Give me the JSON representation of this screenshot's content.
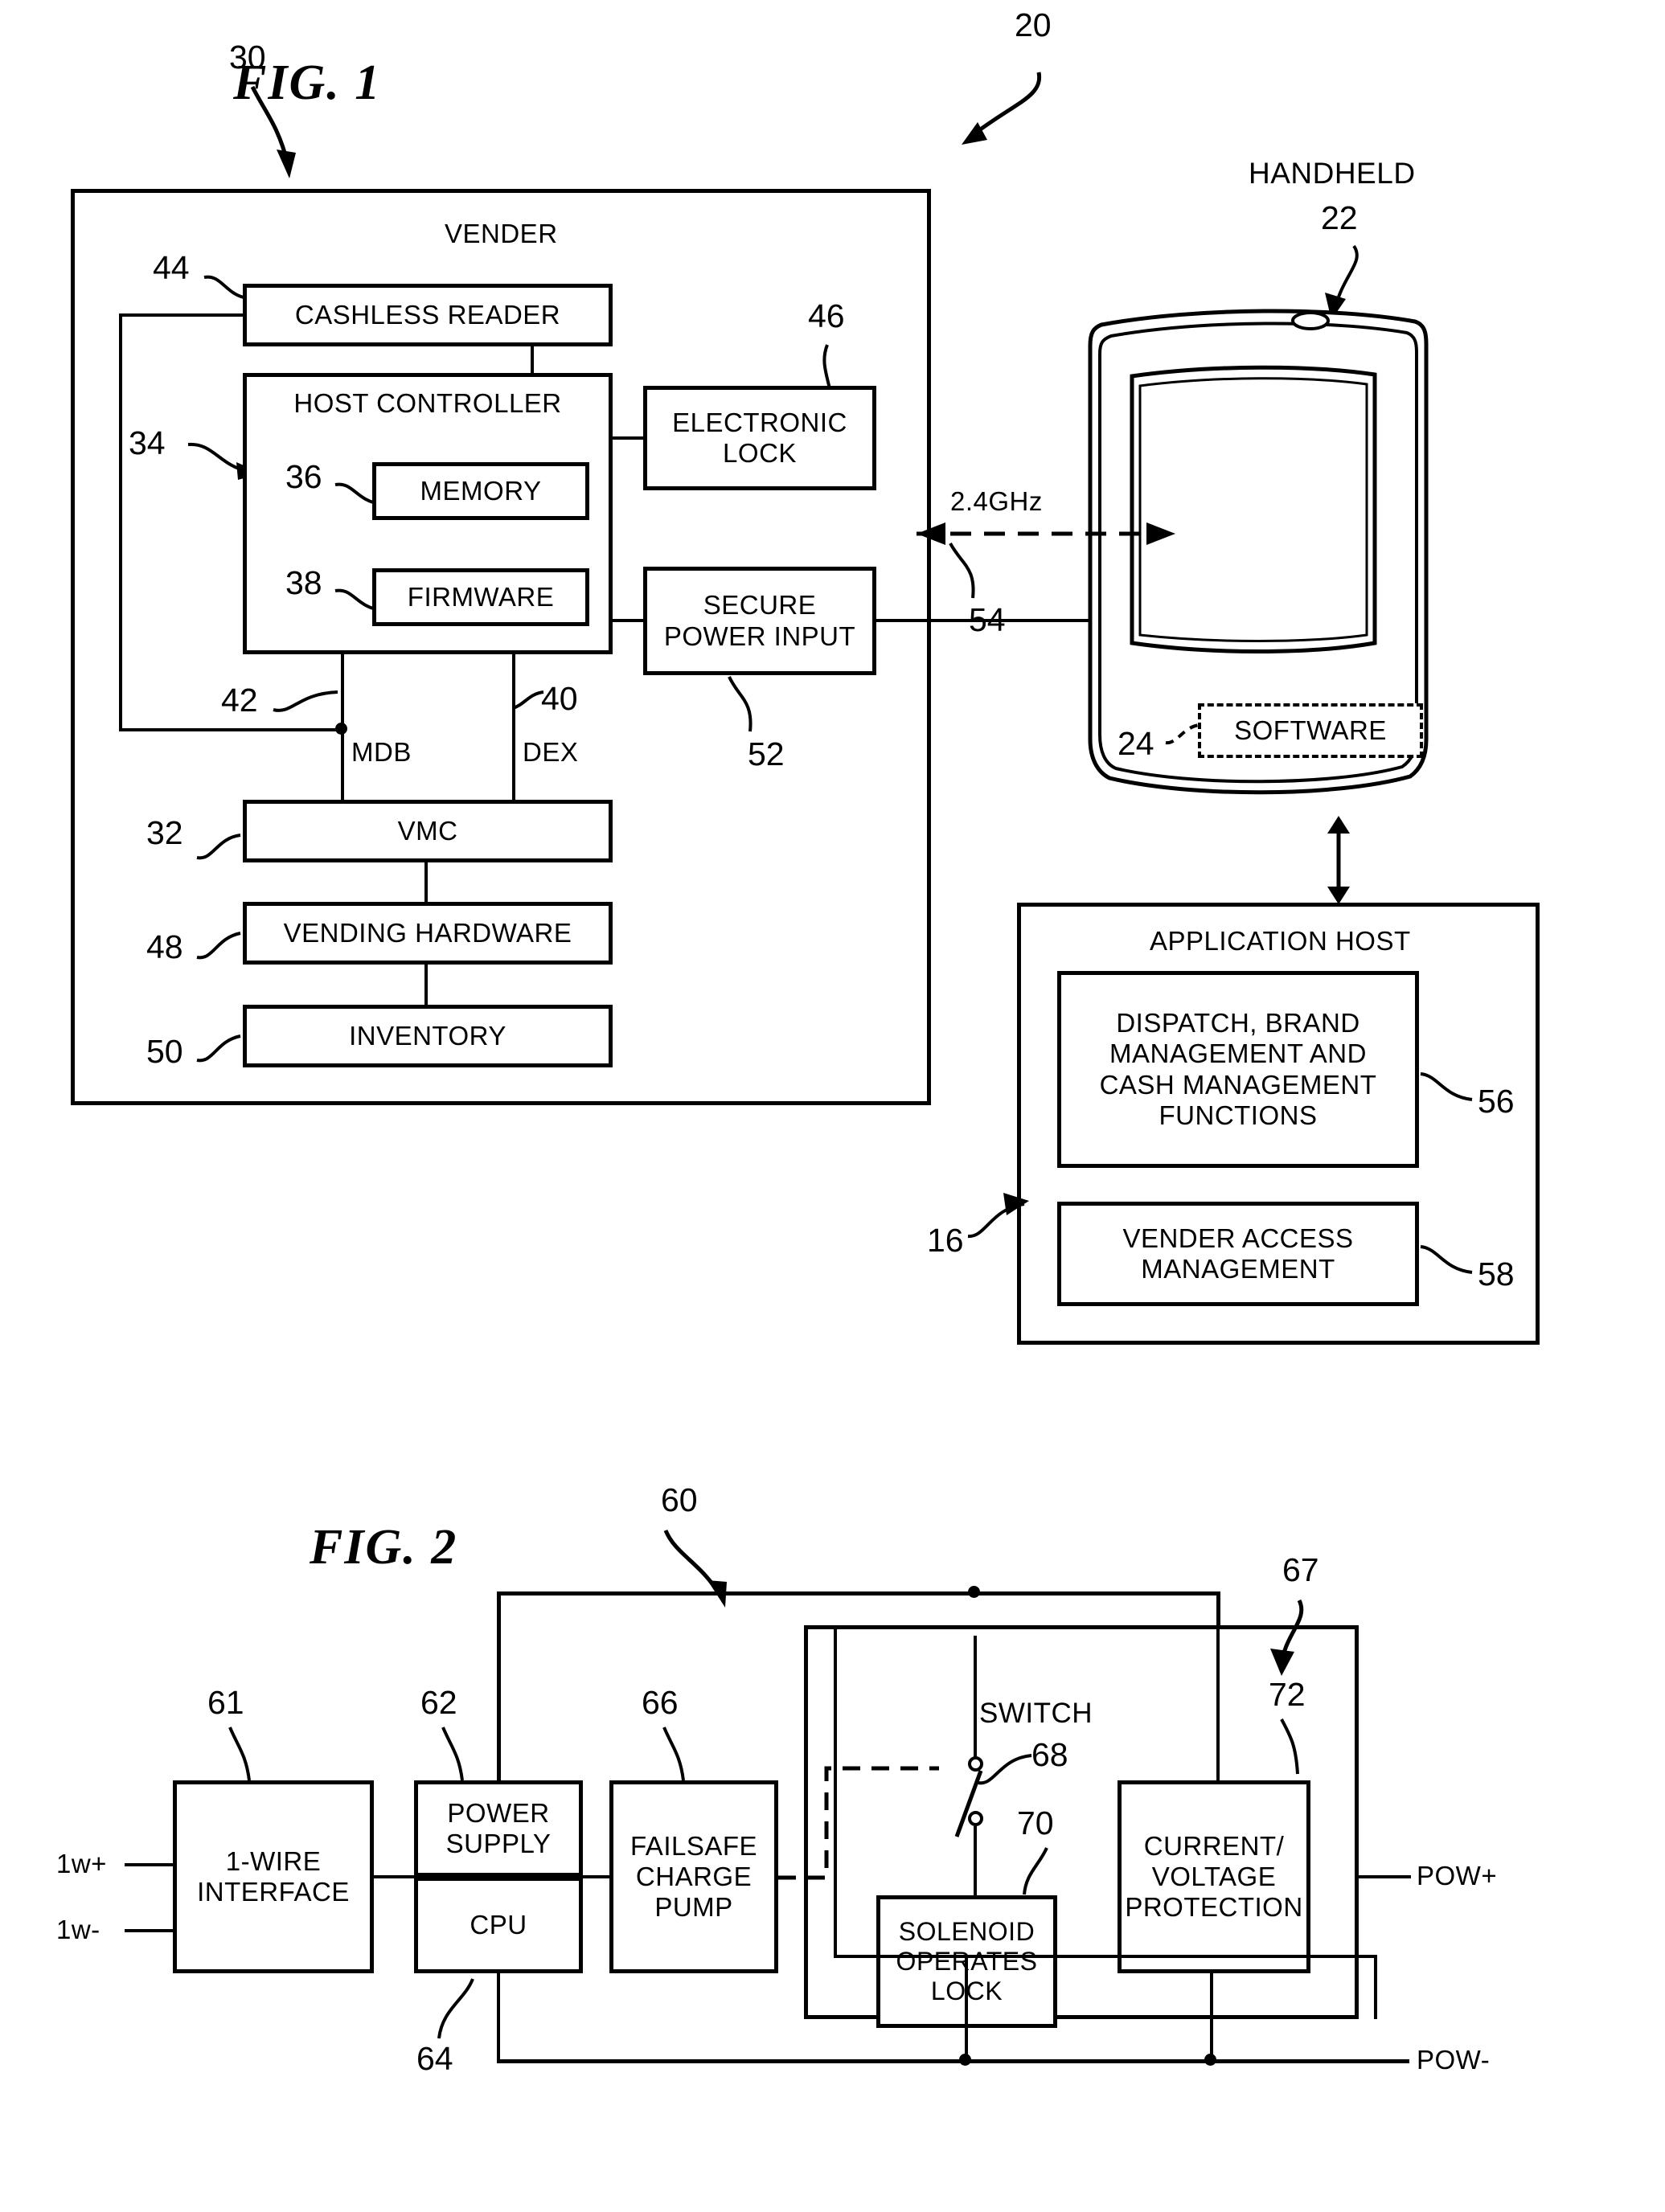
{
  "figures": [
    {
      "id": "fig1",
      "title": "FIG. 1",
      "system_ref": "20"
    },
    {
      "id": "fig2",
      "title": "FIG. 2",
      "system_ref": "60"
    }
  ],
  "fig1": {
    "title": "FIG. 1",
    "system_ref": "20",
    "vender": {
      "label": "VENDER",
      "ref": "30",
      "blocks": [
        {
          "key": "cashless_reader",
          "label": "CASHLESS READER",
          "ref": "44"
        },
        {
          "key": "host_controller",
          "label": "HOST CONTROLLER",
          "ref": "34"
        },
        {
          "key": "memory",
          "label": "MEMORY",
          "ref": "36"
        },
        {
          "key": "firmware",
          "label": "FIRMWARE",
          "ref": "38"
        },
        {
          "key": "electronic_lock",
          "label": "ELECTRONIC\nLOCK",
          "ref": "46"
        },
        {
          "key": "secure_power_input",
          "label": "SECURE\nPOWER INPUT",
          "ref": "52"
        },
        {
          "key": "vmc",
          "label": "VMC",
          "ref": "32"
        },
        {
          "key": "vending_hardware",
          "label": "VENDING HARDWARE",
          "ref": "48"
        },
        {
          "key": "inventory",
          "label": "INVENTORY",
          "ref": "50"
        }
      ],
      "bus_labels": [
        {
          "key": "mdb",
          "label": "MDB",
          "ref": "42"
        },
        {
          "key": "dex",
          "label": "DEX",
          "ref": "40"
        }
      ]
    },
    "handheld": {
      "label": "HANDHELD",
      "ref": "22",
      "software_label": "SOFTWARE",
      "software_ref": "24"
    },
    "wireless_link": {
      "label": "2.4GHz",
      "ref": "54"
    },
    "application_host": {
      "label": "APPLICATION HOST",
      "ref": "16",
      "blocks": [
        {
          "key": "functions",
          "label": "DISPATCH, BRAND\nMANAGEMENT AND\nCASH MANAGEMENT\nFUNCTIONS",
          "ref": "56"
        },
        {
          "key": "vender_access",
          "label": "VENDER ACCESS\nMANAGEMENT",
          "ref": "58"
        }
      ]
    }
  },
  "fig2": {
    "title": "FIG. 2",
    "system_ref": "60",
    "terminals": [
      {
        "key": "1w_plus",
        "label": "1w+"
      },
      {
        "key": "1w_minus",
        "label": "1w-"
      },
      {
        "key": "pow_plus",
        "label": "POW+"
      },
      {
        "key": "pow_minus",
        "label": "POW-"
      }
    ],
    "blocks": [
      {
        "key": "one_wire_interface",
        "label": "1-WIRE\nINTERFACE",
        "ref": "61"
      },
      {
        "key": "power_supply",
        "label": "POWER\nSUPPLY",
        "ref": "62"
      },
      {
        "key": "cpu",
        "label": "CPU",
        "ref": "64"
      },
      {
        "key": "failsafe_charge_pump",
        "label": "FAILSAFE\nCHARGE\nPUMP",
        "ref": "66"
      },
      {
        "key": "solenoid",
        "label": "SOLENOID\nOPERATES\nLOCK",
        "ref": "70"
      },
      {
        "key": "protection",
        "label": "CURRENT/\nVOLTAGE\nPROTECTION",
        "ref": "72"
      }
    ],
    "switch": {
      "label": "SWITCH",
      "ref": "68"
    },
    "enclosure_ref": "67"
  },
  "colors": {
    "ink": "#000000",
    "paper": "#ffffff"
  }
}
